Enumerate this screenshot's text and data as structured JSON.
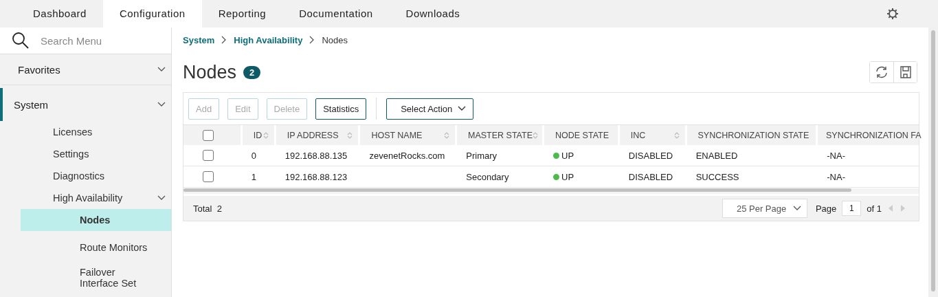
{
  "tabs": [
    {
      "label": "Dashboard",
      "selected": false
    },
    {
      "label": "Configuration",
      "selected": true
    },
    {
      "label": "Reporting",
      "selected": false
    },
    {
      "label": "Documentation",
      "selected": false
    },
    {
      "label": "Downloads",
      "selected": false
    }
  ],
  "search": {
    "placeholder": "Search Menu"
  },
  "sidebar": {
    "sections": [
      {
        "label": "Favorites",
        "selected": false
      },
      {
        "label": "System",
        "selected": true,
        "items": [
          {
            "label": "Licenses",
            "selected": false
          },
          {
            "label": "Settings",
            "selected": false
          },
          {
            "label": "Diagnostics",
            "selected": false
          },
          {
            "label": "High Availability",
            "selected": false,
            "expanded": true,
            "children": [
              {
                "label": "Nodes",
                "selected": true
              },
              {
                "label": "Route Monitors",
                "selected": false
              },
              {
                "label": "Failover Interface Set",
                "selected": false
              }
            ]
          }
        ]
      }
    ]
  },
  "breadcrumb": [
    {
      "label": "System",
      "link": true
    },
    {
      "label": "High Availability",
      "link": true
    },
    {
      "label": "Nodes",
      "link": false
    }
  ],
  "page": {
    "title": "Nodes",
    "count": "2"
  },
  "toolbar": {
    "buttons": [
      {
        "label": "Add",
        "disabled": true
      },
      {
        "label": "Edit",
        "disabled": true
      },
      {
        "label": "Delete",
        "disabled": true
      },
      {
        "label": "Statistics",
        "disabled": false
      }
    ],
    "action_menu": "Select Action"
  },
  "table": {
    "select_all_checked": false,
    "columns": [
      {
        "label": "ID",
        "sortable": true
      },
      {
        "label": "IP ADDRESS",
        "sortable": true
      },
      {
        "label": "HOST NAME",
        "sortable": true
      },
      {
        "label": "MASTER STATE",
        "sortable": true
      },
      {
        "label": "NODE STATE",
        "sortable": false
      },
      {
        "label": "INC",
        "sortable": true
      },
      {
        "label": "SYNCHRONIZATION STATE",
        "sortable": false
      },
      {
        "label": "SYNCHRONIZATION FA"
      }
    ],
    "rows": [
      {
        "checked": false,
        "id": "0",
        "ip": "192.168.88.135",
        "host": "zevenetRocks.com",
        "master": "Primary",
        "node_state": "UP",
        "color": "#4cbb4c",
        "inc": "DISABLED",
        "sync": "ENABLED",
        "sync_fail": "-NA-"
      },
      {
        "checked": false,
        "id": "1",
        "ip": "192.168.88.123",
        "host": "",
        "master": "Secondary",
        "node_state": "UP",
        "color": "#4cbb4c",
        "inc": "DISABLED",
        "sync": "SUCCESS",
        "sync_fail": "-NA-"
      }
    ]
  },
  "footer": {
    "total_label": "Total",
    "total": "2",
    "per_page": "25 Per Page",
    "page_label": "Page",
    "page": "1",
    "of": "of 1"
  }
}
